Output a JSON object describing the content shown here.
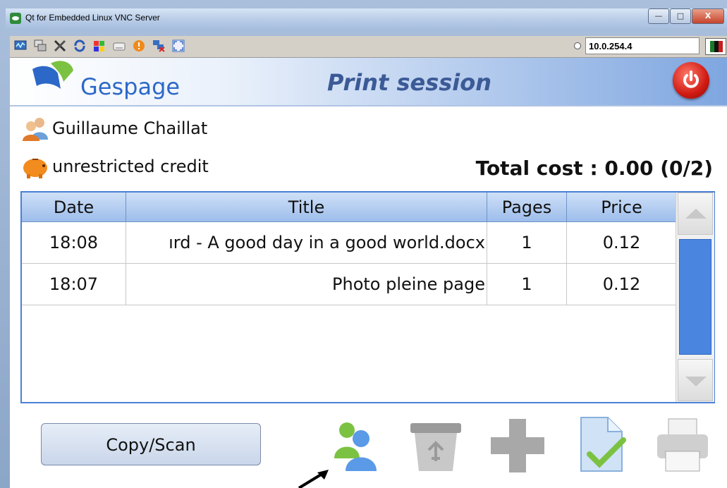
{
  "window": {
    "title": "Qt for Embedded Linux VNC Server",
    "buttons": [
      "—",
      "□",
      "X"
    ]
  },
  "vnc_toolbar": {
    "icons": [
      "monitor-icon",
      "windows-icon",
      "tools-icon",
      "refresh-icon",
      "colors-icon",
      "keyboard-icon",
      "alert-icon",
      "disconnect-icon",
      "fullscreen-icon"
    ],
    "ip_address": "10.0.254.4"
  },
  "header": {
    "logo_text": "Gespage",
    "screen_title": "Print session"
  },
  "user": {
    "name": "Guillaume Chaillat",
    "credit": "unrestricted credit"
  },
  "total": {
    "label": "Total cost : 0.00  (0/2)"
  },
  "table": {
    "columns": [
      "Date",
      "Title",
      "Pages",
      "Price"
    ],
    "rows": [
      {
        "date": "18:08",
        "title": "ırd - A good day in a good world.docx",
        "pages": "1",
        "price": "0.12"
      },
      {
        "date": "18:07",
        "title": "Photo pleine page",
        "pages": "1",
        "price": "0.12"
      }
    ]
  },
  "actions": {
    "copy_scan_label": "Copy/Scan",
    "icons": [
      "users-icon",
      "recycle-bin-icon",
      "add-icon",
      "document-check-icon",
      "printer-icon"
    ]
  },
  "colors": {
    "accent": "#4a86e0",
    "header_title": "#3b5a96",
    "power_red": "#d01a12",
    "logo_green": "#7cc242",
    "logo_blue": "#2c68c8"
  }
}
